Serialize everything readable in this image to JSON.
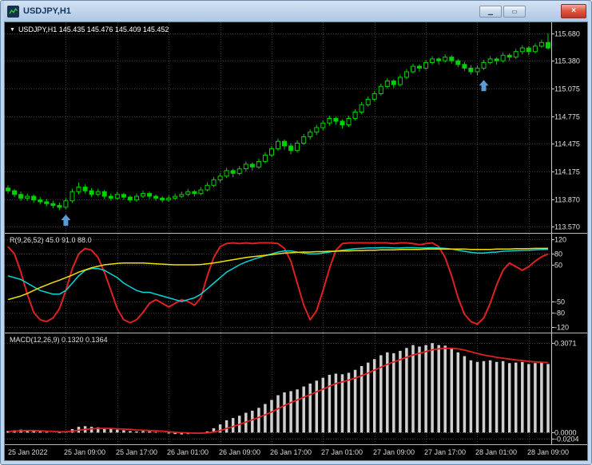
{
  "window": {
    "title": "USDJPY,H1",
    "controls": {
      "minimize_glyph": "▁",
      "restore_glyph": "▭",
      "close_glyph": "×"
    }
  },
  "main_chart": {
    "collapse_icon_glyph": "▼",
    "info_line": "USDJPY,H1 145.435 145.476 145.409 145.452"
  },
  "colors": {
    "background": "#000000",
    "grid": "#3d3d3d",
    "axis_line": "#c8c8c8",
    "axis_text": "#e0e0e0",
    "window_chrome": "#bfd5ee",
    "titlebar_text": "#12365e",
    "close_red": "#d84a38",
    "candle_green": "#00d000",
    "arrow_blue": "#5b9bd5"
  },
  "time_axis": {
    "grid_indices": [
      9,
      17,
      25,
      33,
      41,
      49,
      57,
      65,
      73,
      81
    ],
    "labels": [
      {
        "text": "25 Jan 2022",
        "index": 0
      },
      {
        "text": "25 Jan 09:00",
        "index": 9
      },
      {
        "text": "25 Jan 17:00",
        "index": 17
      },
      {
        "text": "26 Jan 01:00",
        "index": 25
      },
      {
        "text": "26 Jan 09:00",
        "index": 33
      },
      {
        "text": "26 Jan 17:00",
        "index": 41
      },
      {
        "text": "27 Jan 01:00",
        "index": 49
      },
      {
        "text": "27 Jan 09:00",
        "index": 57
      },
      {
        "text": "27 Jan 17:00",
        "index": 65
      },
      {
        "text": "28 Jan 01:00",
        "index": 73
      },
      {
        "text": "28 Jan 09:00",
        "index": 81
      }
    ]
  },
  "chart_data": [
    {
      "type": "candlestick",
      "title": "USDJPY,H1",
      "ylim": [
        113.5,
        115.8
      ],
      "y_ticks": [
        {
          "label": "115.680",
          "value": 115.68
        },
        {
          "label": "115.380",
          "value": 115.38
        },
        {
          "label": "115.075",
          "value": 115.075
        },
        {
          "label": "114.775",
          "value": 114.775
        },
        {
          "label": "114.475",
          "value": 114.475
        },
        {
          "label": "114.175",
          "value": 114.175
        },
        {
          "label": "113.870",
          "value": 113.87
        },
        {
          "label": "113.570",
          "value": 113.57
        }
      ],
      "candle_color": "#00d000",
      "bull_fill": "#000000",
      "marker_color": "#5b9bd5",
      "markers": [
        {
          "index": 9,
          "price": 113.7,
          "type": "buy-arrow"
        },
        {
          "index": 74,
          "price": 115.17,
          "type": "buy-arrow"
        }
      ],
      "candles": [
        [
          113.99,
          114.02,
          113.93,
          113.96
        ],
        [
          113.96,
          113.98,
          113.89,
          113.92
        ],
        [
          113.92,
          113.95,
          113.85,
          113.88
        ],
        [
          113.88,
          113.93,
          113.85,
          113.9
        ],
        [
          113.9,
          113.92,
          113.83,
          113.86
        ],
        [
          113.86,
          113.89,
          113.81,
          113.84
        ],
        [
          113.84,
          113.87,
          113.79,
          113.82
        ],
        [
          113.82,
          113.85,
          113.77,
          113.8
        ],
        [
          113.8,
          113.83,
          113.75,
          113.78
        ],
        [
          113.78,
          113.88,
          113.76,
          113.85
        ],
        [
          113.85,
          113.98,
          113.83,
          113.95
        ],
        [
          113.95,
          114.05,
          113.92,
          114.0
        ],
        [
          114.0,
          114.03,
          113.93,
          113.96
        ],
        [
          113.96,
          113.99,
          113.89,
          113.92
        ],
        [
          113.92,
          113.98,
          113.9,
          113.95
        ],
        [
          113.95,
          113.97,
          113.87,
          113.9
        ],
        [
          113.9,
          113.93,
          113.85,
          113.88
        ],
        [
          113.88,
          113.95,
          113.86,
          113.92
        ],
        [
          113.92,
          113.94,
          113.86,
          113.89
        ],
        [
          113.89,
          113.91,
          113.83,
          113.86
        ],
        [
          113.86,
          113.93,
          113.84,
          113.9
        ],
        [
          113.9,
          113.96,
          113.88,
          113.93
        ],
        [
          113.93,
          113.95,
          113.87,
          113.9
        ],
        [
          113.9,
          113.92,
          113.85,
          113.88
        ],
        [
          113.88,
          113.9,
          113.83,
          113.86
        ],
        [
          113.86,
          113.91,
          113.84,
          113.88
        ],
        [
          113.88,
          113.93,
          113.86,
          113.9
        ],
        [
          113.9,
          113.95,
          113.88,
          113.92
        ],
        [
          113.92,
          113.98,
          113.9,
          113.95
        ],
        [
          113.95,
          113.97,
          113.9,
          113.93
        ],
        [
          113.93,
          114.0,
          113.91,
          113.97
        ],
        [
          113.97,
          114.05,
          113.95,
          114.02
        ],
        [
          114.02,
          114.11,
          114.0,
          114.08
        ],
        [
          114.08,
          114.15,
          114.05,
          114.12
        ],
        [
          114.12,
          114.21,
          114.1,
          114.18
        ],
        [
          114.18,
          114.2,
          114.11,
          114.15
        ],
        [
          114.15,
          114.23,
          114.13,
          114.2
        ],
        [
          114.2,
          114.28,
          114.17,
          114.25
        ],
        [
          114.25,
          114.27,
          114.18,
          114.22
        ],
        [
          114.22,
          114.31,
          114.2,
          114.28
        ],
        [
          114.28,
          114.38,
          114.26,
          114.35
        ],
        [
          114.35,
          114.45,
          114.33,
          114.42
        ],
        [
          114.42,
          114.53,
          114.4,
          114.5
        ],
        [
          114.5,
          114.52,
          114.41,
          114.45
        ],
        [
          114.45,
          114.48,
          114.36,
          114.4
        ],
        [
          114.4,
          114.51,
          114.38,
          114.48
        ],
        [
          114.48,
          114.58,
          114.46,
          114.55
        ],
        [
          114.55,
          114.63,
          114.52,
          114.6
        ],
        [
          114.6,
          114.68,
          114.57,
          114.65
        ],
        [
          114.65,
          114.73,
          114.62,
          114.7
        ],
        [
          114.7,
          114.78,
          114.67,
          114.75
        ],
        [
          114.75,
          114.77,
          114.68,
          114.72
        ],
        [
          114.72,
          114.74,
          114.64,
          114.68
        ],
        [
          114.68,
          114.78,
          114.66,
          114.75
        ],
        [
          114.75,
          114.85,
          114.73,
          114.82
        ],
        [
          114.82,
          114.93,
          114.8,
          114.9
        ],
        [
          114.9,
          114.99,
          114.88,
          114.96
        ],
        [
          114.96,
          115.05,
          114.94,
          115.02
        ],
        [
          115.02,
          115.13,
          115.0,
          115.1
        ],
        [
          115.1,
          115.19,
          115.08,
          115.16
        ],
        [
          115.16,
          115.18,
          115.08,
          115.12
        ],
        [
          115.12,
          115.23,
          115.1,
          115.2
        ],
        [
          115.2,
          115.29,
          115.18,
          115.26
        ],
        [
          115.26,
          115.35,
          115.24,
          115.32
        ],
        [
          115.32,
          115.34,
          115.26,
          115.3
        ],
        [
          115.3,
          115.39,
          115.28,
          115.36
        ],
        [
          115.36,
          115.43,
          115.34,
          115.4
        ],
        [
          115.4,
          115.42,
          115.34,
          115.38
        ],
        [
          115.38,
          115.45,
          115.36,
          115.42
        ],
        [
          115.42,
          115.44,
          115.35,
          115.38
        ],
        [
          115.38,
          115.4,
          115.31,
          115.34
        ],
        [
          115.34,
          115.37,
          115.27,
          115.3
        ],
        [
          115.3,
          115.33,
          115.23,
          115.26
        ],
        [
          115.26,
          115.33,
          115.22,
          115.3
        ],
        [
          115.3,
          115.39,
          115.28,
          115.36
        ],
        [
          115.36,
          115.43,
          115.34,
          115.4
        ],
        [
          115.4,
          115.42,
          115.34,
          115.38
        ],
        [
          115.38,
          115.47,
          115.36,
          115.44
        ],
        [
          115.44,
          115.46,
          115.38,
          115.42
        ],
        [
          115.42,
          115.51,
          115.4,
          115.48
        ],
        [
          115.48,
          115.55,
          115.45,
          115.52
        ],
        [
          115.52,
          115.54,
          115.44,
          115.48
        ],
        [
          115.48,
          115.57,
          115.46,
          115.54
        ],
        [
          115.54,
          115.61,
          115.52,
          115.58
        ],
        [
          115.58,
          115.68,
          115.5,
          115.52
        ]
      ]
    },
    {
      "type": "line",
      "label": "R(9,26,52) 45.0 91.0 88.0",
      "ylim": [
        -135,
        135
      ],
      "y_ticks": [
        {
          "label": "120",
          "value": 120
        },
        {
          "label": "80",
          "value": 80
        },
        {
          "label": "50",
          "value": 50
        },
        {
          "label": "-50",
          "value": -50
        },
        {
          "label": "-80",
          "value": -80
        },
        {
          "label": "-120",
          "value": -120
        }
      ],
      "series": [
        {
          "name": "fast-line",
          "color": "#e02020",
          "width": 2,
          "values": [
            100,
            80,
            30,
            -30,
            -80,
            -100,
            -105,
            -95,
            -70,
            -20,
            40,
            80,
            95,
            90,
            70,
            30,
            -20,
            -70,
            -100,
            -108,
            -100,
            -80,
            -55,
            -45,
            -55,
            -65,
            -55,
            -45,
            -50,
            -60,
            -40,
            20,
            70,
            100,
            108,
            110,
            108,
            110,
            108,
            110,
            110,
            110,
            108,
            95,
            60,
            0,
            -60,
            -100,
            -75,
            -20,
            40,
            90,
            108,
            110,
            110,
            110,
            110,
            110,
            110,
            110,
            108,
            110,
            110,
            108,
            105,
            108,
            110,
            100,
            70,
            20,
            -40,
            -85,
            -105,
            -112,
            -95,
            -55,
            -5,
            35,
            55,
            45,
            35,
            45,
            60,
            72,
            80
          ]
        },
        {
          "name": "mid-line",
          "color": "#00d8d8",
          "width": 1.5,
          "values": [
            20,
            15,
            10,
            0,
            -10,
            -20,
            -25,
            -30,
            -30,
            -20,
            0,
            20,
            35,
            40,
            40,
            35,
            25,
            15,
            0,
            -10,
            -20,
            -25,
            -25,
            -30,
            -35,
            -40,
            -45,
            -50,
            -45,
            -40,
            -30,
            -15,
            0,
            15,
            30,
            40,
            50,
            58,
            64,
            70,
            75,
            80,
            85,
            88,
            88,
            85,
            82,
            80,
            80,
            82,
            85,
            88,
            90,
            92,
            94,
            95,
            96,
            96,
            97,
            97,
            96,
            96,
            97,
            97,
            96,
            96,
            97,
            96,
            95,
            93,
            90,
            87,
            84,
            82,
            82,
            84,
            85,
            87,
            88,
            89,
            90,
            90,
            91,
            92,
            92
          ]
        },
        {
          "name": "slow-line",
          "color": "#f0e000",
          "width": 1.5,
          "values": [
            -45,
            -40,
            -35,
            -28,
            -20,
            -12,
            -5,
            2,
            8,
            15,
            22,
            30,
            36,
            42,
            46,
            50,
            52,
            54,
            55,
            55,
            55,
            55,
            54,
            53,
            52,
            51,
            50,
            50,
            50,
            50,
            51,
            53,
            55,
            58,
            61,
            64,
            67,
            70,
            72,
            74,
            76,
            78,
            80,
            82,
            83,
            84,
            85,
            85,
            86,
            86,
            87,
            87,
            88,
            88,
            89,
            89,
            90,
            90,
            91,
            91,
            91,
            92,
            92,
            92,
            92,
            93,
            93,
            93,
            93,
            93,
            93,
            93,
            92,
            92,
            92,
            92,
            93,
            93,
            93,
            94,
            94,
            94,
            95,
            95,
            95
          ]
        }
      ]
    },
    {
      "type": "bar",
      "label": "MACD(12,26,9) 0.1320 0.1364",
      "ylim": [
        -0.04,
        0.34
      ],
      "y_ticks": [
        {
          "label": "0.3071",
          "value": 0.3071
        },
        {
          "label": "0.0000",
          "value": 0.0
        },
        {
          "label": "-0.0204",
          "value": -0.0204
        }
      ],
      "histogram": {
        "color": "#cfcfcf",
        "values": [
          0.005,
          0.008,
          0.01,
          0.008,
          0.006,
          0.004,
          0.002,
          0.0,
          -0.002,
          0.004,
          0.012,
          0.02,
          0.022,
          0.02,
          0.018,
          0.015,
          0.012,
          0.01,
          0.008,
          0.005,
          0.004,
          0.005,
          0.004,
          0.002,
          0.0,
          -0.003,
          -0.005,
          -0.006,
          -0.005,
          -0.004,
          -0.002,
          0.004,
          0.015,
          0.028,
          0.042,
          0.05,
          0.058,
          0.068,
          0.075,
          0.085,
          0.098,
          0.112,
          0.128,
          0.138,
          0.142,
          0.148,
          0.158,
          0.168,
          0.178,
          0.188,
          0.198,
          0.202,
          0.2,
          0.205,
          0.215,
          0.228,
          0.24,
          0.252,
          0.265,
          0.275,
          0.272,
          0.28,
          0.29,
          0.3,
          0.295,
          0.3,
          0.307,
          0.3,
          0.298,
          0.288,
          0.275,
          0.262,
          0.248,
          0.242,
          0.245,
          0.248,
          0.242,
          0.245,
          0.238,
          0.24,
          0.242,
          0.235,
          0.238,
          0.24,
          0.235
        ]
      },
      "signal": {
        "color": "#e02020",
        "values": [
          0.004,
          0.005,
          0.006,
          0.007,
          0.007,
          0.006,
          0.005,
          0.004,
          0.003,
          0.003,
          0.005,
          0.008,
          0.011,
          0.013,
          0.014,
          0.014,
          0.014,
          0.013,
          0.012,
          0.011,
          0.009,
          0.008,
          0.007,
          0.006,
          0.005,
          0.003,
          0.001,
          0.0,
          -0.001,
          -0.002,
          -0.002,
          -0.001,
          0.002,
          0.007,
          0.014,
          0.021,
          0.028,
          0.036,
          0.044,
          0.052,
          0.061,
          0.071,
          0.082,
          0.093,
          0.103,
          0.112,
          0.121,
          0.13,
          0.14,
          0.149,
          0.159,
          0.168,
          0.174,
          0.18,
          0.187,
          0.195,
          0.204,
          0.214,
          0.224,
          0.234,
          0.242,
          0.25,
          0.258,
          0.266,
          0.272,
          0.278,
          0.284,
          0.287,
          0.289,
          0.289,
          0.287,
          0.283,
          0.277,
          0.271,
          0.266,
          0.262,
          0.258,
          0.255,
          0.252,
          0.249,
          0.247,
          0.244,
          0.242,
          0.241,
          0.24
        ]
      }
    }
  ]
}
